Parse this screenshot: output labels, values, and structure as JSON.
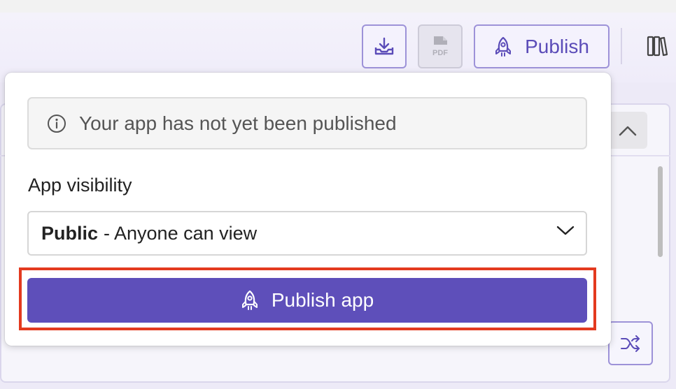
{
  "toolbar": {
    "download_icon": "download-tray-icon",
    "pdf_icon": "pdf-file-icon",
    "pdf_text": "PDF",
    "publish_label": "Publish",
    "library_icon": "library-books-icon",
    "accent": "#5e4fba"
  },
  "publish_popover": {
    "notice_text": "Your app has not yet been published",
    "visibility_label": "App visibility",
    "visibility_select": {
      "selected_bold": "Public",
      "selected_rest": "- Anyone can view"
    },
    "publish_button_label": "Publish app",
    "highlight_color": "#e33a1f"
  }
}
